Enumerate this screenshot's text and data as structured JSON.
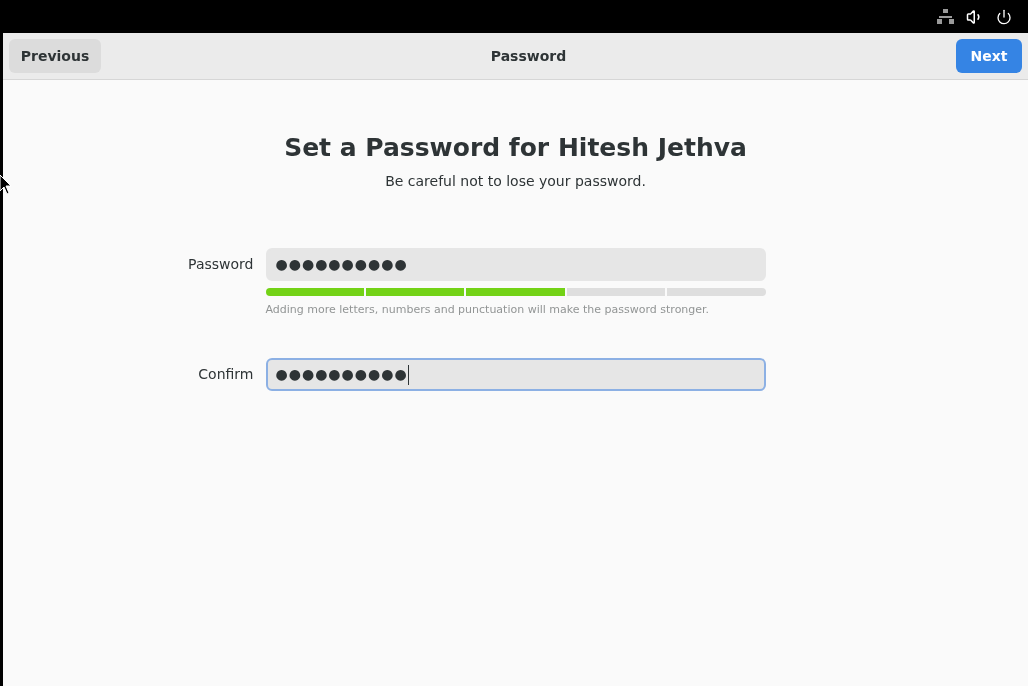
{
  "header": {
    "previous": "Previous",
    "title": "Password",
    "next": "Next"
  },
  "heading": "Set a Password for Hitesh Jethva",
  "subtitle": "Be careful not to lose your password.",
  "fields": [
    {
      "label": "Password",
      "value": "●●●●●●●●●●",
      "focused": false
    },
    {
      "label": "Confirm",
      "value": "●●●●●●●●●●",
      "focused": true
    }
  ],
  "strength": {
    "level": 0.6,
    "hint": "Adding more letters, numbers and punctuation will make the password stronger."
  }
}
